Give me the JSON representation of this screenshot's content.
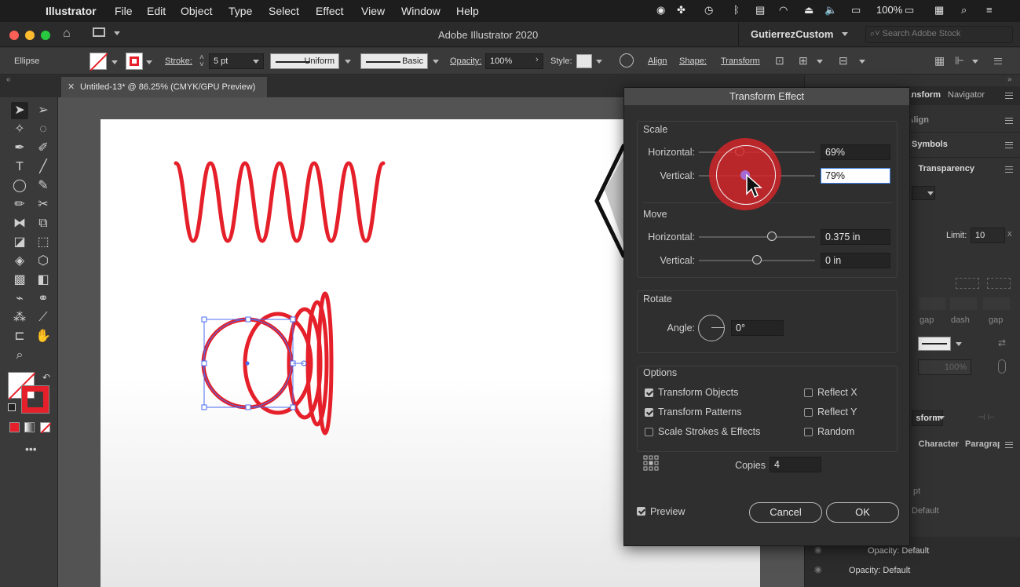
{
  "menubar": {
    "app_name": "Illustrator",
    "items": [
      "File",
      "Edit",
      "Object",
      "Type",
      "Select",
      "Effect",
      "View",
      "Window",
      "Help"
    ],
    "battery": "100%"
  },
  "appbar": {
    "title": "Adobe Illustrator 2020",
    "workspace": "GutierrezCustom",
    "search_placeholder": "Search Adobe Stock"
  },
  "control": {
    "selection_type": "Ellipse",
    "stroke_label": "Stroke:",
    "stroke_weight": "5 pt",
    "profile": "Uniform",
    "brush": "Basic",
    "opacity_label": "Opacity:",
    "opacity_value": "100%",
    "style_label": "Style:",
    "align": "Align",
    "shape": "Shape:",
    "transform": "Transform"
  },
  "document_tab": {
    "title": "Untitled-13* @ 86.25% (CMYK/GPU Preview)"
  },
  "panels": {
    "tab_transform": "Transform",
    "tab_navigator": "Navigator",
    "align": "Align",
    "symbols": "Symbols",
    "transparency": "Transparency",
    "limit_label": "Limit:",
    "limit_value": "10",
    "gap1": "gap",
    "dash": "dash",
    "gap2": "gap",
    "field_100": "100%",
    "transform_dd": "Transform",
    "character": "Character",
    "paragraph": "Paragraph",
    "pt": "pt",
    "default1": "Default",
    "opacity1": "Opacity: Default",
    "opacity2": "Opacity: Default"
  },
  "dialog": {
    "title": "Transform Effect",
    "scale": {
      "title": "Scale",
      "horizontal_label": "Horizontal:",
      "horizontal_value": "69%",
      "vertical_label": "Vertical:",
      "vertical_value": "79%"
    },
    "move": {
      "title": "Move",
      "horizontal_label": "Horizontal:",
      "horizontal_value": "0.375 in",
      "vertical_label": "Vertical:",
      "vertical_value": "0 in"
    },
    "rotate": {
      "title": "Rotate",
      "angle_label": "Angle:",
      "angle_value": "0°"
    },
    "options": {
      "title": "Options",
      "transform_objects": "Transform Objects",
      "transform_patterns": "Transform Patterns",
      "scale_strokes": "Scale Strokes & Effects",
      "reflect_x": "Reflect X",
      "reflect_y": "Reflect Y",
      "random": "Random"
    },
    "copies_label": "Copies",
    "copies_value": "4",
    "preview": "Preview",
    "cancel": "Cancel",
    "ok": "OK"
  },
  "colors": {
    "stroke_red": "#e5202a",
    "selection_blue": "#4a6cf0",
    "cursor_halo": "#d8262b"
  }
}
